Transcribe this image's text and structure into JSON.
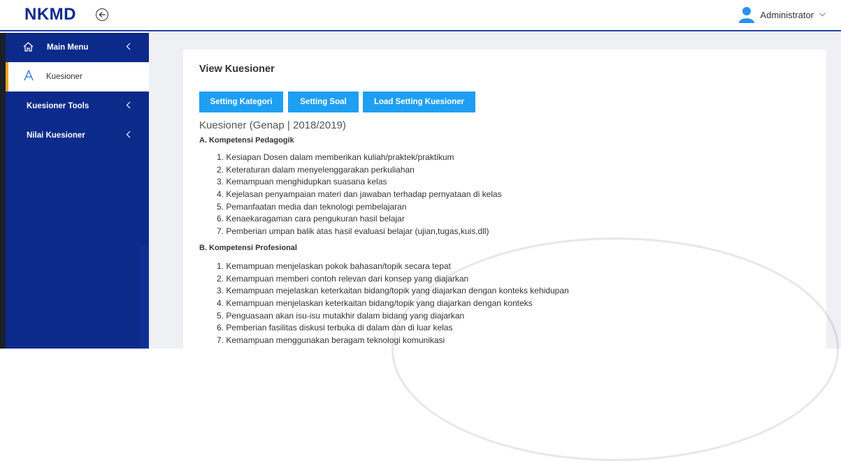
{
  "app": {
    "brand": "NKMD",
    "user_name": "Administrator"
  },
  "sidebar": {
    "items": [
      {
        "label": "Main Menu",
        "icon": "home-icon"
      },
      {
        "label": "Kuesioner",
        "icon": "letter-a-icon"
      },
      {
        "label": "Kuesioner Tools"
      },
      {
        "label": "Nilai Kuesioner"
      }
    ]
  },
  "main": {
    "title": "View Kuesioner",
    "buttons": {
      "kategori": "Setting Kategori",
      "soal": "Setting Soal",
      "load": "Load Setting Kuesioner"
    },
    "heading": "Kuesioner (Genap | 2018/2019)",
    "sections": [
      {
        "title": "A. Kompetensi Pedagogik",
        "items": [
          "1. Kesiapan Dosen dalam memberikan kuliah/praktek/praktikum",
          "2. Keteraturan dalam menyelenggarakan perkuliahan",
          "3. Kemampuan menghidupkan suasana kelas",
          "4. Kejelasan penyampaian materi dan jawaban terhadap pernyataan di kelas",
          "5. Pemanfaatan media dan teknologi pembelajaran",
          "6. Kenaekaragaman cara pengukuran hasil belajar",
          "7. Pemberian umpan balik atas hasil evaluasi belajar (ujian,tugas,kuis,dll)"
        ]
      },
      {
        "title": "B. Kompetensi Profesional",
        "items": [
          "1. Kemampuan menjelaskan pokok bahasan/topik secara tepat",
          "2. Kemampuan memberi contoh relevan dari konsep yang diajarkan",
          "3. Kemampuan mejelaskan keterkaitan bidang/topik yang diajarkan dengan konteks kehidupan",
          "4. Kemampuan menjelaskan keterkaitan bidang/topik yang diajarkan dengan konteks",
          "5. Penguasaan akan isu-isu mutakhir dalam bidang yang diajarkan",
          "6. Pemberian fasilitas diskusi terbuka di dalam dan di luar kelas",
          "7. Kemampuan menggunakan beragam teknologi komunikasi"
        ]
      }
    ]
  }
}
